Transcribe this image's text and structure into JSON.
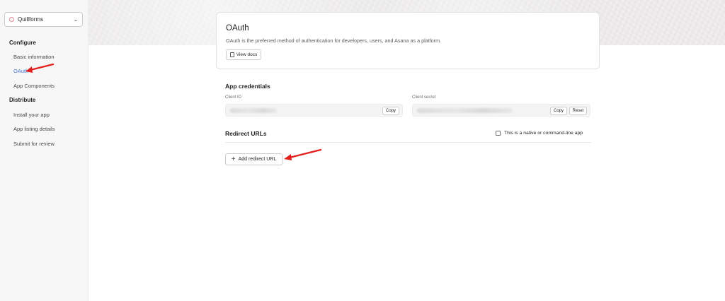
{
  "sidebar": {
    "app_name": "Quillforms",
    "sections": [
      {
        "title": "Configure",
        "items": [
          {
            "label": "Basic information"
          },
          {
            "label": "OAuth"
          },
          {
            "label": "App Components"
          }
        ]
      },
      {
        "title": "Distribute",
        "items": [
          {
            "label": "Install your app"
          },
          {
            "label": "App listing details"
          },
          {
            "label": "Submit for review"
          }
        ]
      }
    ]
  },
  "oauth_card": {
    "title": "OAuth",
    "description": "OAuth is the preferred method of authentication for developers, users, and Asana as a platform.",
    "docs_button": "View docs"
  },
  "credentials": {
    "title": "App credentials",
    "client_id_label": "Client ID",
    "client_secret_label": "Client secret",
    "copy_label": "Copy",
    "reset_label": "Reset"
  },
  "redirect": {
    "title": "Redirect URLs",
    "native_checkbox_label": "This is a native or command-line app",
    "native_checked": false,
    "add_button": "Add redirect URL"
  },
  "colors": {
    "accent_link": "#4573d2",
    "annotation_arrow": "#e3211c"
  },
  "annotations": [
    "arrow pointing at OAuth nav item",
    "arrow pointing at Add redirect URL button"
  ]
}
